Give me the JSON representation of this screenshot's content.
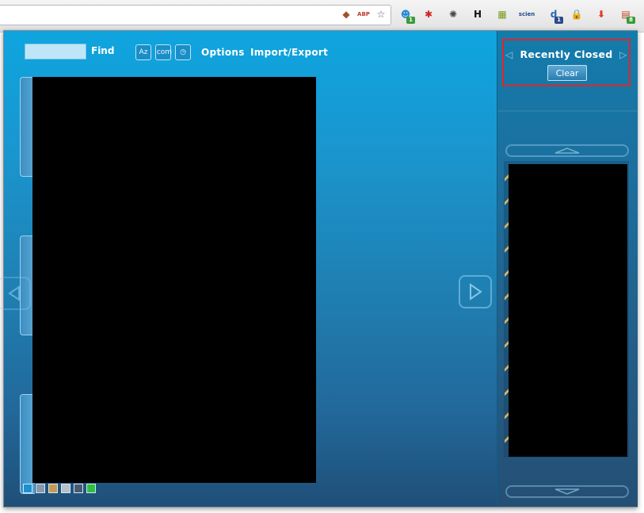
{
  "toolbar": {
    "icons": [
      {
        "name": "pinned-site-icon",
        "glyph": "◆",
        "color": "#a0522d"
      },
      {
        "name": "adblock-icon",
        "glyph": "ABP",
        "color": "#c0392b"
      },
      {
        "name": "star-icon",
        "glyph": "☆",
        "color": "#555555"
      },
      {
        "name": "ghost-icon",
        "glyph": "☻",
        "color": "#2a8bd6",
        "badge": "1",
        "badge_color": "#3a9a3a"
      },
      {
        "name": "asterisk-icon",
        "glyph": "✱",
        "color": "#d22020"
      },
      {
        "name": "bug-icon",
        "glyph": "✺",
        "color": "#444444"
      },
      {
        "name": "h-letter-icon",
        "glyph": "H",
        "color": "#111111"
      },
      {
        "name": "spreadsheet-icon",
        "glyph": "▦",
        "color": "#7a9a20"
      },
      {
        "name": "science-icon",
        "glyph": "scien",
        "color": "#1f4a8c"
      },
      {
        "name": "d-letter-icon",
        "glyph": "d",
        "color": "#2a6ab0",
        "badge": "1",
        "badge_color": "#2a4a8a"
      },
      {
        "name": "lock-icon",
        "glyph": "🔒",
        "color": "#777777"
      },
      {
        "name": "download-icon",
        "glyph": "⬇",
        "color": "#e23a2a"
      },
      {
        "name": "tab-manager-icon",
        "glyph": "▤",
        "color": "#c04020",
        "badge": "8",
        "badge_color": "#3a9a3a"
      }
    ]
  },
  "popup": {
    "find_label": "Find",
    "find_value": "",
    "sort_buttons": [
      {
        "name": "sort-az-button",
        "label": "Az"
      },
      {
        "name": "sort-domain-button",
        "label": ".com"
      },
      {
        "name": "sort-recent-button",
        "label": "◷"
      }
    ],
    "options_label": "Options",
    "import_export_label": "Import/Export",
    "swatches": [
      "#1e90d0",
      "#8a9aa8",
      "#c89a50",
      "#b8c0c8",
      "#4a5a70",
      "#30c040"
    ]
  },
  "sidebar": {
    "title": "Recently Closed",
    "clear_label": "Clear",
    "prev_glyph": "◁",
    "next_glyph": "▷"
  }
}
